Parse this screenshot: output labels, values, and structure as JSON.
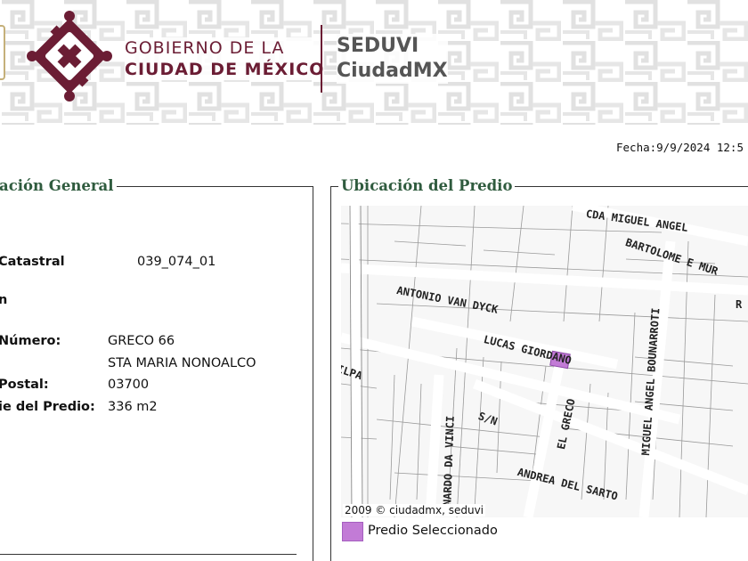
{
  "header": {
    "gobierno_line1": "GOBIERNO DE LA",
    "gobierno_line2": "CIUDAD DE MÉXICO",
    "agency_line1": "SEDUVI",
    "agency_line2": "CiudadMX",
    "brand_color": "#6b1d34"
  },
  "fecha": "Fecha:9/9/2024 12:5",
  "panels": {
    "general_title": "ación General",
    "ubicacion_title": "Ubicación del Predio"
  },
  "fields": [
    {
      "label": "Catastral",
      "value": "039_074_01"
    },
    {
      "label": "n",
      "value": ""
    },
    {
      "label": "Número:",
      "value": "GRECO 66"
    },
    {
      "label": "",
      "value": "STA MARIA NONOALCO"
    },
    {
      "label": "Postal:",
      "value": "03700"
    },
    {
      "label": "ie del Predio:",
      "value": "336 m2"
    }
  ],
  "map": {
    "streets": [
      "CDA MIGUEL ANGEL",
      "BARTOLOME E MUR",
      "R",
      "ANTONIO VAN DYCK",
      "LUCAS GIORDANO",
      "MIGUEL ANGEL BOUNARROTI",
      "ILPA",
      "ONARDO DA VINCI",
      "S/N",
      "EL GRECO",
      "ANDREA DEL SARTO"
    ],
    "copyright": "2009 © ciudadmx, seduvi",
    "selected_color": "#c27bd6"
  },
  "legend": {
    "label": "Predio Seleccionado"
  }
}
